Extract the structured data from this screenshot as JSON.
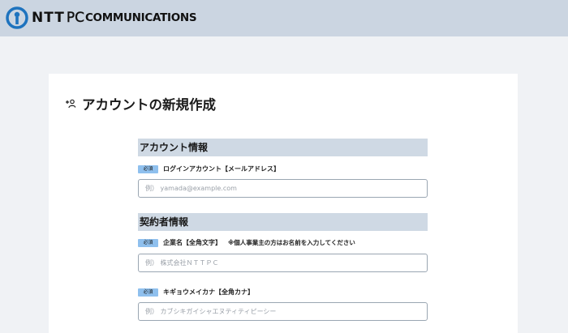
{
  "header": {
    "logo": {
      "ntt": "NTT",
      "pc": "PC",
      "communications": "COMMUNICATIONS"
    }
  },
  "page": {
    "title": "アカウントの新規作成",
    "title_icon": "add-user-icon"
  },
  "sections": {
    "account": {
      "title": "アカウント情報"
    },
    "contractor": {
      "title": "契約者情報"
    }
  },
  "fields": {
    "login": {
      "required": "必須",
      "label": "ログインアカウント【メールアドレス】",
      "value": "",
      "placeholder": "例） yamada@example.com"
    },
    "company": {
      "required": "必須",
      "label": "企業名【全角文字】",
      "note": "※個人事業主の方はお名前を入力してください",
      "value": "",
      "placeholder": "例） 株式会社ＮＴＴＰＣ"
    },
    "company_kana": {
      "required": "必須",
      "label": "キギョウメイカナ【全角カナ】",
      "value": "",
      "placeholder": "例） カブシキガイシャエヌティティピーシー"
    }
  },
  "colors": {
    "header_bg": "#cbd5e1",
    "page_bg": "#f0f2f5",
    "section_header_bg": "#cfd9e4",
    "required_badge": "#8fc0ee",
    "logo_blue": "#1e73be"
  }
}
